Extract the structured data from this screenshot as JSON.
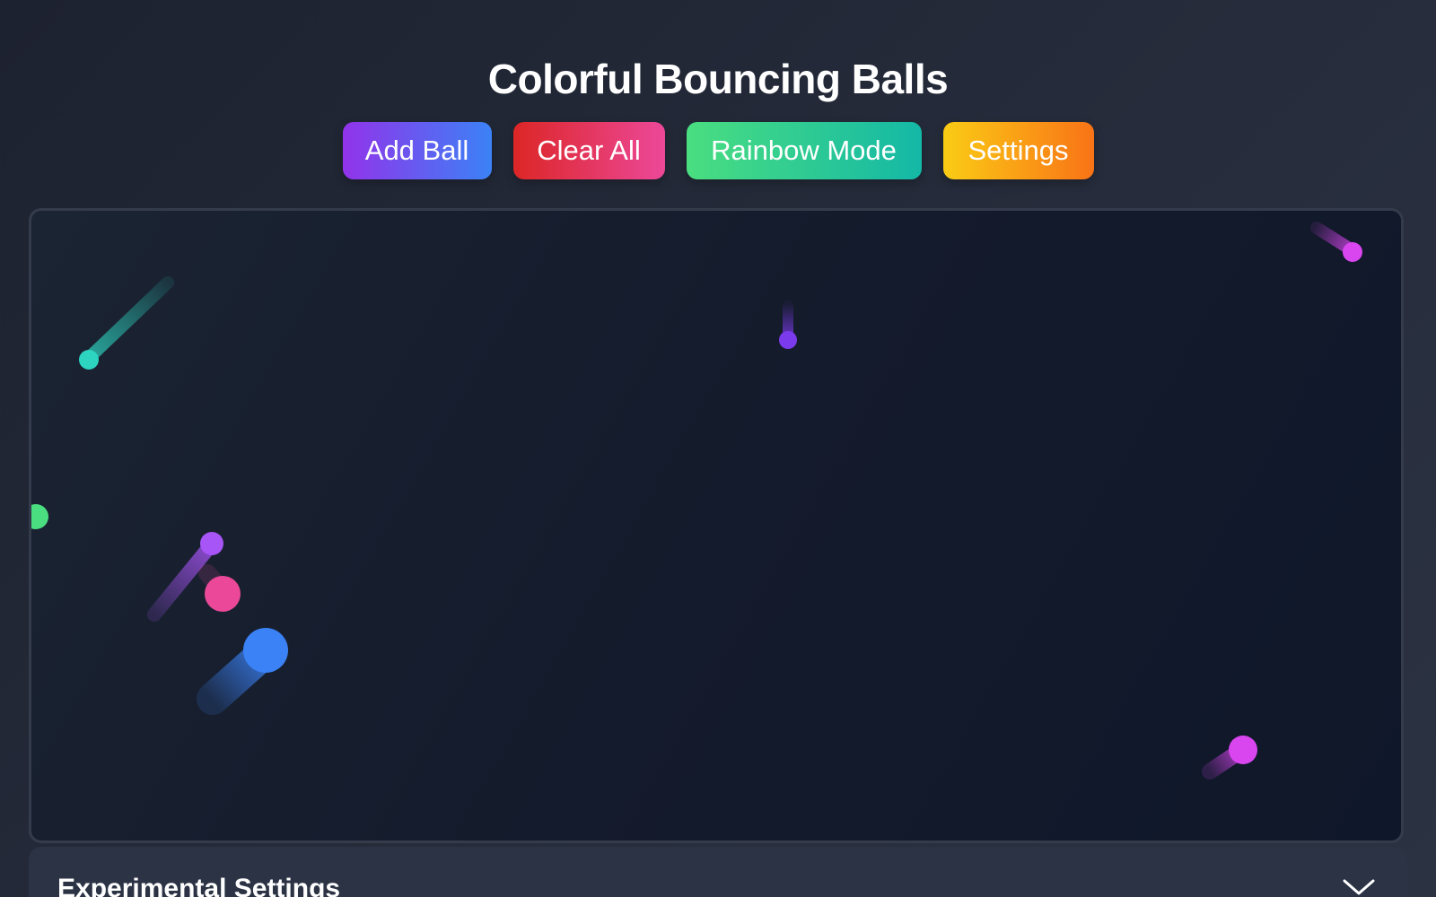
{
  "header": {
    "title": "Colorful Bouncing Balls"
  },
  "toolbar": {
    "add_label": "Add Ball",
    "clear_label": "Clear All",
    "rainbow_label": "Rainbow Mode",
    "settings_label": "Settings"
  },
  "panel": {
    "title": "Experimental Settings",
    "toggle_icon": "chevron-down-icon"
  },
  "colors": {
    "teal": "#2dd4bf",
    "violet": "#7c3aed",
    "magenta": "#d946ef",
    "green": "#4ade80",
    "purple": "#a855f7",
    "pink": "#ec4899",
    "blue": "#3b82f6"
  }
}
